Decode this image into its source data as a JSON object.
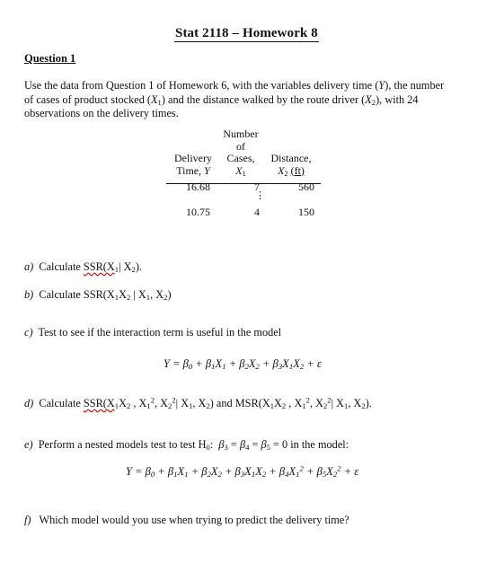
{
  "document": {
    "title": "Stat 2118 – Homework 8",
    "question_heading": "Question 1",
    "intro": {
      "line1": "Use the data from Question 1 of Homework 6, with the variables delivery time (Y), the number",
      "line2": "of cases of product stocked (X₁) and the distance walked by the route driver (X₂), with 24",
      "line3": "observations on the delivery times."
    },
    "table": {
      "headers": [
        [
          "Delivery",
          "Time, Y"
        ],
        [
          "Number",
          "of",
          "Cases,",
          "X₁"
        ],
        [
          "Distance,",
          "X₂ (ft)"
        ]
      ],
      "rows": [
        [
          "16.68",
          "7",
          "560"
        ],
        [
          "10.75",
          "4",
          "150"
        ]
      ],
      "ellipsis": "⋮"
    },
    "parts": [
      {
        "label": "a)",
        "text": "Calculate SSR(X₁| X₂)."
      },
      {
        "label": "b)",
        "text": "Calculate SSR(X₁X₂ | X₁, X₂)"
      },
      {
        "label": "c)",
        "text": "Test to see if the interaction term is useful in the model"
      },
      {
        "label": "d)",
        "text": "Calculate SSR(X₁X₂ , X₁², X₂²| X₁, X₂) and MSR(X₁X₂ , X₁², X₂²| X₁, X₂)."
      },
      {
        "label": "e)",
        "text": "Perform a nested models test to test H₀: β₃ = β₄ = β₅ = 0 in the model:"
      },
      {
        "label": "f)",
        "text": "Which model would you use when trying to predict the delivery time?"
      }
    ],
    "equations": {
      "interaction_model": "Y = β₀ + β₁X₁ + β₂X₂ + β₃X₁X₂ + ε",
      "full_model": "Y = β₀ + β₁X₁ + β₂X₂ + β₃X₁X₂ + β₄X₁² + β₅X₂² + ε"
    }
  }
}
